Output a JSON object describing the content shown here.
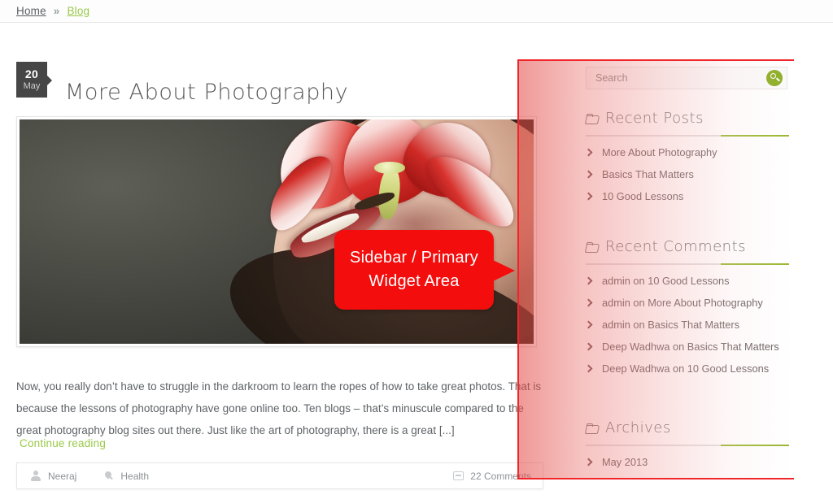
{
  "breadcrumb": {
    "home": "Home",
    "separator": "»",
    "current": "Blog"
  },
  "post": {
    "date": {
      "day": "20",
      "month": "May"
    },
    "title": "More About Photography",
    "excerpt": "Now, you really don’t have to struggle in the darkroom to learn the ropes of how to take great photos. That is because the lessons of photography have gone online too. Ten blogs – that’s minuscule compared to the great photography blog sites out there. Just like the art of photography, there is a great [...]",
    "continue_reading": "Continue reading",
    "meta": {
      "author": "Neeraj",
      "category": "Health",
      "comments": "22 Comments"
    }
  },
  "sidebar": {
    "search": {
      "placeholder": "Search",
      "value": "",
      "button_icon": "search-icon"
    },
    "widgets": [
      {
        "title": "Recent Posts",
        "icon": "folder-icon",
        "items": [
          "More About Photography",
          "Basics That Matters",
          "10 Good Lessons"
        ]
      },
      {
        "title": "Recent Comments",
        "icon": "folder-icon",
        "items": [
          "admin on 10 Good Lessons",
          "admin on More About Photography",
          "admin on Basics That Matters",
          "Deep Wadhwa on Basics That Matters",
          "Deep Wadhwa on 10 Good Lessons"
        ]
      },
      {
        "title": "Archives",
        "icon": "folder-icon",
        "items": [
          "May 2013"
        ]
      }
    ]
  },
  "annotation": {
    "callout_text": "Sidebar / Primary Widget Area",
    "overlay_color": "#f0262a",
    "callout_color": "#f30d0d"
  },
  "colors": {
    "accent_green": "#9ac948",
    "divider_green": "#9ab832",
    "search_button": "#8dae27",
    "date_badge": "#464646",
    "body_text": "#5e6366"
  }
}
